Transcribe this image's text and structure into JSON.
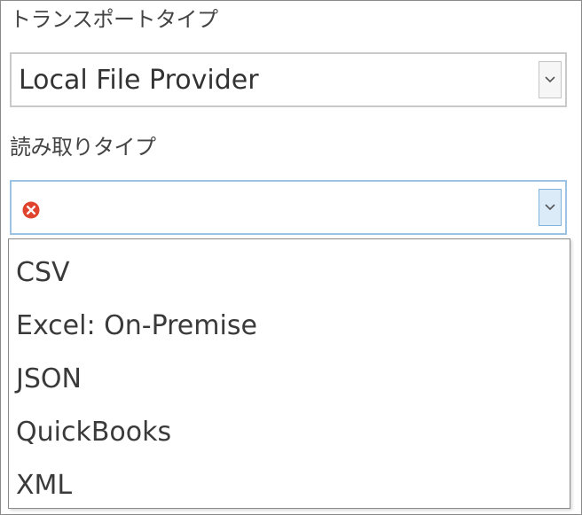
{
  "transport": {
    "label": "トランスポートタイプ",
    "value": "Local File Provider"
  },
  "read_type": {
    "label": "読み取りタイプ",
    "value": "",
    "status_icon": "error-circle-icon",
    "status_color": "#e0442f"
  },
  "dropdown": {
    "options": [
      {
        "label": "CSV"
      },
      {
        "label": "Excel: On-Premise"
      },
      {
        "label": "JSON"
      },
      {
        "label": "QuickBooks"
      },
      {
        "label": "XML"
      }
    ]
  },
  "colors": {
    "focus_border": "#9dc3e4",
    "text": "#333333"
  }
}
